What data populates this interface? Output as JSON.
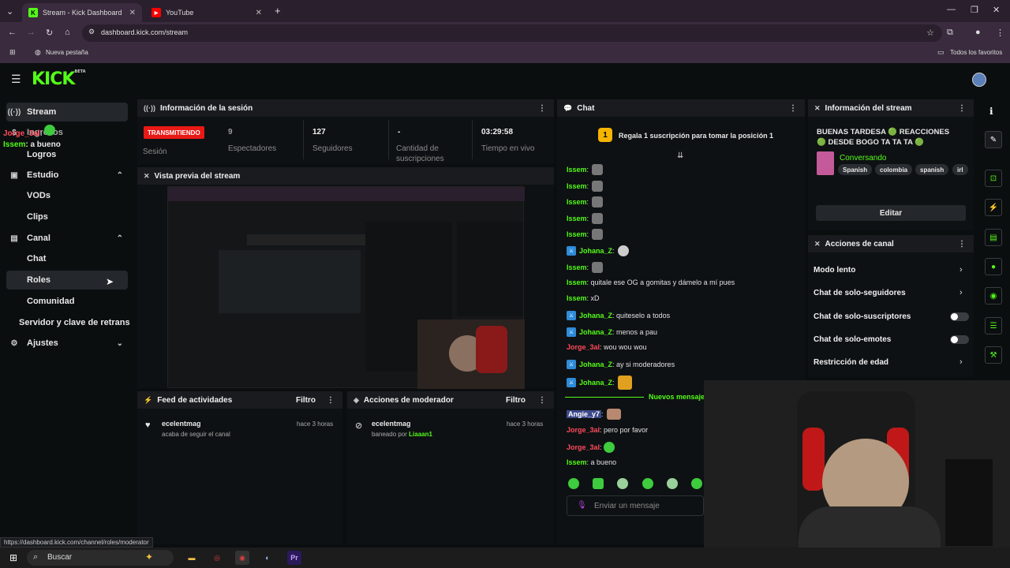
{
  "browser": {
    "tabs": [
      {
        "title": "Stream - Kick Dashboard",
        "icon": "K"
      },
      {
        "title": "YouTube",
        "icon": "▶"
      }
    ],
    "url": "dashboard.kick.com/stream",
    "bookmark_new_tab": "Nueva pestaña",
    "bookmark_all": "Todos los favoritos",
    "status_url": "https://dashboard.kick.com/channel/roles/moderator"
  },
  "kick": {
    "logo": "KICK",
    "logo_badge": "BETA"
  },
  "sidebar": {
    "stream": "Stream",
    "ingresos": "Ingresos",
    "logros": "Logros",
    "estudio": "Estudio",
    "vods": "VODs",
    "clips": "Clips",
    "canal": "Canal",
    "chat": "Chat",
    "roles": "Roles",
    "comunidad": "Comunidad",
    "servidor": "Servidor y clave de retrans",
    "ajustes": "Ajustes",
    "overlay_user1": "Jorge_3al",
    "overlay_user2": "Issem",
    "overlay_msg2": "a bueno"
  },
  "session": {
    "title": "Información de la sesión",
    "status": "TRANSMITIENDO",
    "status_label": "Sesión",
    "viewers": "9",
    "viewers_label": "Espectadores",
    "followers": "127",
    "followers_label": "Seguidores",
    "subs": "-",
    "subs_label_1": "Cantidad de",
    "subs_label_2": "suscripciones",
    "live_time": "03:29:58",
    "live_label": "Tiempo en vivo"
  },
  "preview": {
    "title": "Vista previa del stream"
  },
  "feed": {
    "title": "Feed de actividades",
    "filter": "Filtro",
    "user": "ecelentmag",
    "action": "acaba de seguir el canal",
    "time": "hace 3 horas"
  },
  "modactions": {
    "title": "Acciones de moderador",
    "filter": "Filtro",
    "user": "ecelentmag",
    "action": "baneado por",
    "by": "Liaaan1",
    "time": "hace 3 horas"
  },
  "chat": {
    "title": "Chat",
    "gift_rank": "1",
    "gift_text": "Regala 1 suscripción para tomar la posición 1",
    "new_messages": "Nuevos mensaje",
    "input_placeholder": "Enviar un mensaje",
    "messages": [
      {
        "user": "Issem",
        "text": "",
        "color": "green"
      },
      {
        "user": "Issem",
        "text": "",
        "color": "green"
      },
      {
        "user": "Issem",
        "text": "",
        "color": "green"
      },
      {
        "user": "Issem",
        "text": "",
        "color": "green"
      },
      {
        "user": "Issem",
        "text": "",
        "color": "green"
      },
      {
        "user": "Johana_Z",
        "text": "",
        "color": "green",
        "mod": true
      },
      {
        "user": "Issem",
        "text": "",
        "color": "green"
      },
      {
        "user": "Issem",
        "text": "quitale ese OG a gomitas y dámelo a mí pues",
        "color": "green"
      },
      {
        "user": "Issem",
        "text": "xD",
        "color": "green"
      },
      {
        "user": "Johana_Z",
        "text": "quiteselo a todos",
        "color": "green",
        "mod": true
      },
      {
        "user": "Johana_Z",
        "text": "menos a pau",
        "color": "green",
        "mod": true
      },
      {
        "user": "Jorge_3al",
        "text": "wou wou wou",
        "color": "red"
      },
      {
        "user": "Johana_Z",
        "text": "ay si moderadores",
        "color": "green",
        "mod": true
      },
      {
        "user": "Johana_Z",
        "text": "",
        "color": "green",
        "mod": true
      },
      {
        "user": "Angie_y7",
        "text": "",
        "color": "badge"
      },
      {
        "user": "Jorge_3al",
        "text": "pero por favor",
        "color": "red"
      },
      {
        "user": "Jorge_3al",
        "text": "",
        "color": "red"
      },
      {
        "user": "Issem",
        "text": "a bueno",
        "color": "green"
      }
    ]
  },
  "streaminfo": {
    "title": "Información del stream",
    "stream_title": "BUENAS TARDESA 🟢 REACCIONES 🟢 DESDE BOGO TA TA TA 🟢",
    "category": "Conversando",
    "tags": [
      "Spanish",
      "colombia",
      "spanish",
      "irl"
    ],
    "edit": "Editar"
  },
  "channelactions": {
    "title": "Acciones de canal",
    "slow_mode": "Modo lento",
    "followers_only": "Chat de solo-seguidores",
    "subs_only": "Chat de solo-suscriptores",
    "emotes_only": "Chat de solo-emotes",
    "age_restriction": "Restricción de edad"
  },
  "taskbar": {
    "search": "Buscar"
  },
  "colors": {
    "accent": "#53fc18",
    "live_red": "#e91916",
    "panel_header": "#191b1f"
  }
}
